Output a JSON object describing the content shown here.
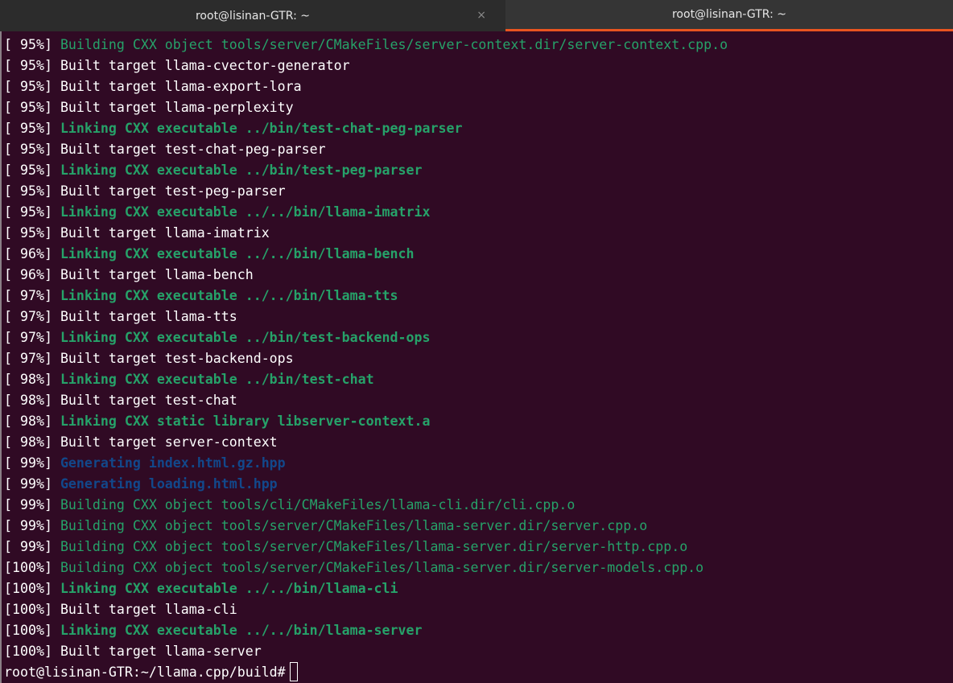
{
  "tabs": [
    {
      "title": "root@lisinan-GTR: ~",
      "close_glyph": "×",
      "active": false
    },
    {
      "title": "root@lisinan-GTR: ~",
      "active": true
    }
  ],
  "colors": {
    "terminal_bg": "#300a24",
    "green": "#26a269",
    "blue": "#12488b",
    "accent_orange": "#e95420"
  },
  "lines": [
    {
      "pct": "[ 95%] ",
      "text": "Building CXX object tools/server/CMakeFiles/server-context.dir/server-context.cpp.o",
      "style": "green"
    },
    {
      "pct": "[ 95%] ",
      "text": "Built target llama-cvector-generator",
      "style": "white"
    },
    {
      "pct": "[ 95%] ",
      "text": "Built target llama-export-lora",
      "style": "white"
    },
    {
      "pct": "[ 95%] ",
      "text": "Built target llama-perplexity",
      "style": "white"
    },
    {
      "pct": "[ 95%] ",
      "text": "Linking CXX executable ../bin/test-chat-peg-parser",
      "style": "green-bold"
    },
    {
      "pct": "[ 95%] ",
      "text": "Built target test-chat-peg-parser",
      "style": "white"
    },
    {
      "pct": "[ 95%] ",
      "text": "Linking CXX executable ../bin/test-peg-parser",
      "style": "green-bold"
    },
    {
      "pct": "[ 95%] ",
      "text": "Built target test-peg-parser",
      "style": "white"
    },
    {
      "pct": "[ 95%] ",
      "text": "Linking CXX executable ../../bin/llama-imatrix",
      "style": "green-bold"
    },
    {
      "pct": "[ 95%] ",
      "text": "Built target llama-imatrix",
      "style": "white"
    },
    {
      "pct": "[ 96%] ",
      "text": "Linking CXX executable ../../bin/llama-bench",
      "style": "green-bold"
    },
    {
      "pct": "[ 96%] ",
      "text": "Built target llama-bench",
      "style": "white"
    },
    {
      "pct": "[ 97%] ",
      "text": "Linking CXX executable ../../bin/llama-tts",
      "style": "green-bold"
    },
    {
      "pct": "[ 97%] ",
      "text": "Built target llama-tts",
      "style": "white"
    },
    {
      "pct": "[ 97%] ",
      "text": "Linking CXX executable ../bin/test-backend-ops",
      "style": "green-bold"
    },
    {
      "pct": "[ 97%] ",
      "text": "Built target test-backend-ops",
      "style": "white"
    },
    {
      "pct": "[ 98%] ",
      "text": "Linking CXX executable ../bin/test-chat",
      "style": "green-bold"
    },
    {
      "pct": "[ 98%] ",
      "text": "Built target test-chat",
      "style": "white"
    },
    {
      "pct": "[ 98%] ",
      "text": "Linking CXX static library libserver-context.a",
      "style": "green-bold"
    },
    {
      "pct": "[ 98%] ",
      "text": "Built target server-context",
      "style": "white"
    },
    {
      "pct": "[ 99%] ",
      "text": "Generating index.html.gz.hpp",
      "style": "blue-bold"
    },
    {
      "pct": "[ 99%] ",
      "text": "Generating loading.html.hpp",
      "style": "blue-bold"
    },
    {
      "pct": "[ 99%] ",
      "text": "Building CXX object tools/cli/CMakeFiles/llama-cli.dir/cli.cpp.o",
      "style": "green"
    },
    {
      "pct": "[ 99%] ",
      "text": "Building CXX object tools/server/CMakeFiles/llama-server.dir/server.cpp.o",
      "style": "green"
    },
    {
      "pct": "[ 99%] ",
      "text": "Building CXX object tools/server/CMakeFiles/llama-server.dir/server-http.cpp.o",
      "style": "green"
    },
    {
      "pct": "[100%] ",
      "text": "Building CXX object tools/server/CMakeFiles/llama-server.dir/server-models.cpp.o",
      "style": "green"
    },
    {
      "pct": "[100%] ",
      "text": "Linking CXX executable ../../bin/llama-cli",
      "style": "green-bold"
    },
    {
      "pct": "[100%] ",
      "text": "Built target llama-cli",
      "style": "white"
    },
    {
      "pct": "[100%] ",
      "text": "Linking CXX executable ../../bin/llama-server",
      "style": "green-bold"
    },
    {
      "pct": "[100%] ",
      "text": "Built target llama-server",
      "style": "white"
    }
  ],
  "prompt": "root@lisinan-GTR:~/llama.cpp/build#"
}
